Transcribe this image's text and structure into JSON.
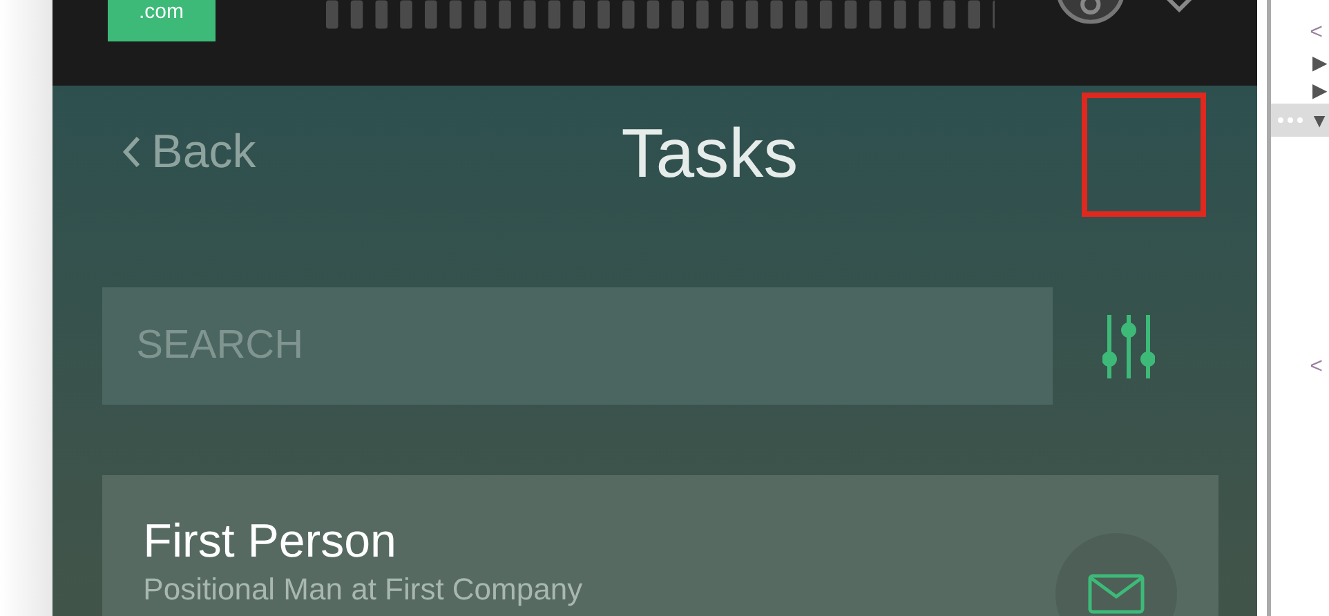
{
  "top_bar": {
    "logo_text": ".com"
  },
  "header": {
    "back_label": "Back",
    "title": "Tasks"
  },
  "search": {
    "placeholder": "SEARCH"
  },
  "tasks": [
    {
      "name": "First Person",
      "subtitle": "Positional Man at First Company"
    }
  ],
  "devtools": {
    "lines": [
      {
        "text": "<",
        "kind": "tag"
      },
      {
        "text": "▶",
        "kind": "arrow"
      },
      {
        "text": "▶",
        "kind": "arrow"
      },
      {
        "text": "▼",
        "kind": "selected"
      },
      {
        "text": "<",
        "kind": "tag"
      }
    ]
  }
}
